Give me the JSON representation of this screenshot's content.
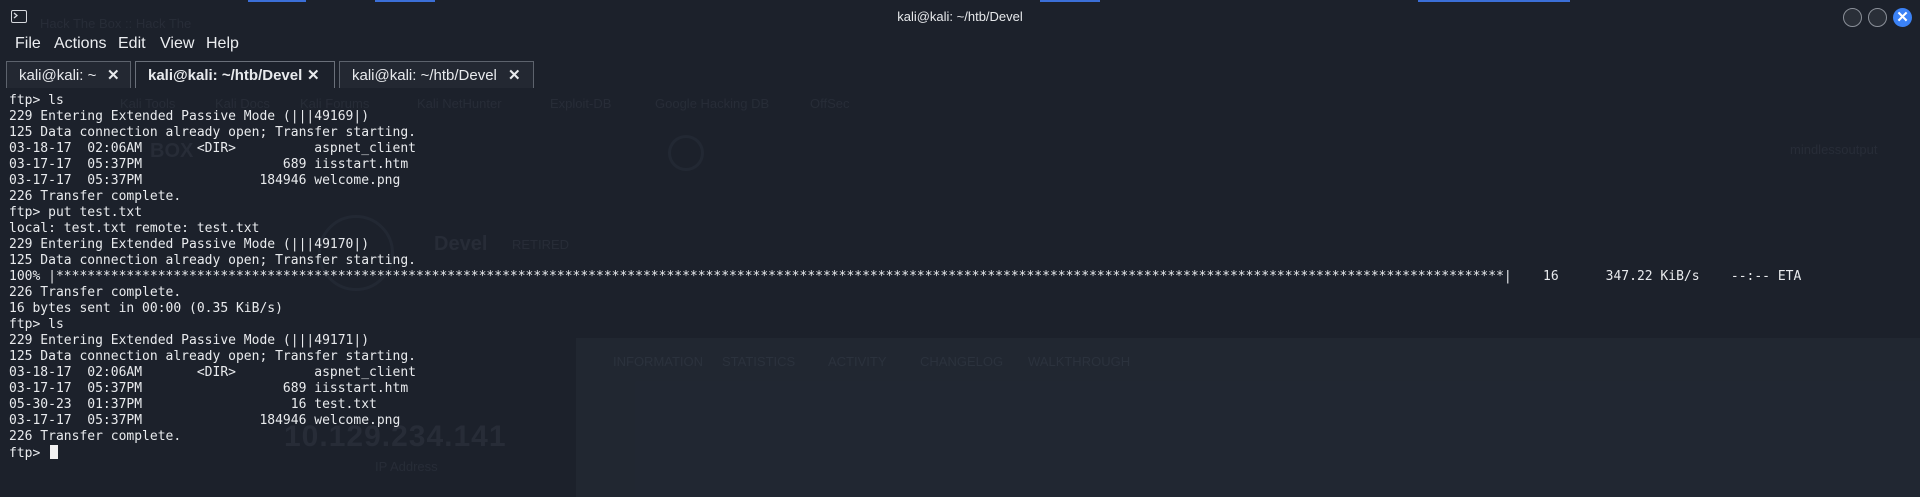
{
  "window": {
    "title": "kali@kali: ~/htb/Devel",
    "colors": {
      "background": "#1c212b",
      "text": "#e9ebee",
      "close_button": "#3b82f6"
    }
  },
  "menu": [
    "File",
    "Actions",
    "Edit",
    "View",
    "Help"
  ],
  "tabs": [
    {
      "label": "kali@kali: ~",
      "close": "✕",
      "active": false
    },
    {
      "label": "kali@kali: ~/htb/Devel",
      "close": "✕",
      "active": true
    },
    {
      "label": "kali@kali: ~/htb/Devel",
      "close": "✕",
      "active": false
    }
  ],
  "background_ghost": {
    "tab_title": "Hack The Box :: Hack The",
    "bookmarks": [
      "Kali Tools",
      "Kali Docs",
      "Kali Forums",
      "Kali NetHunter",
      "Exploit-DB",
      "Google Hacking DB",
      "OffSec"
    ],
    "brand": "BOX",
    "machine_name": "Devel",
    "machine_status": "RETIRED",
    "ip_address": "10.129.234.141",
    "ip_label": "IP Address",
    "panel_tabs": [
      "INFORMATION",
      "STATISTICS",
      "ACTIVITY",
      "CHANGELOG",
      "WALKTHROUGH"
    ],
    "user": "mindlessoutput"
  },
  "terminal": {
    "prompt": "ftp> ",
    "lines": [
      "ftp> ls",
      "229 Entering Extended Passive Mode (|||49169|)",
      "125 Data connection already open; Transfer starting.",
      "03-18-17  02:06AM       <DIR>          aspnet_client",
      "03-17-17  05:37PM                  689 iisstart.htm",
      "03-17-17  05:37PM               184946 welcome.png",
      "226 Transfer complete.",
      "ftp> put test.txt",
      "local: test.txt remote: test.txt",
      "229 Entering Extended Passive Mode (|||49170|)",
      "125 Data connection already open; Transfer starting.",
      "100% |*****************************************************************************************************************************************************************************************|    16      347.22 KiB/s    --:-- ETA",
      "226 Transfer complete.",
      "16 bytes sent in 00:00 (0.35 KiB/s)",
      "ftp> ls",
      "229 Entering Extended Passive Mode (|||49171|)",
      "125 Data connection already open; Transfer starting.",
      "03-18-17  02:06AM       <DIR>          aspnet_client",
      "03-17-17  05:37PM                  689 iisstart.htm",
      "05-30-23  01:37PM                   16 test.txt",
      "03-17-17  05:37PM               184946 welcome.png",
      "226 Transfer complete."
    ]
  }
}
